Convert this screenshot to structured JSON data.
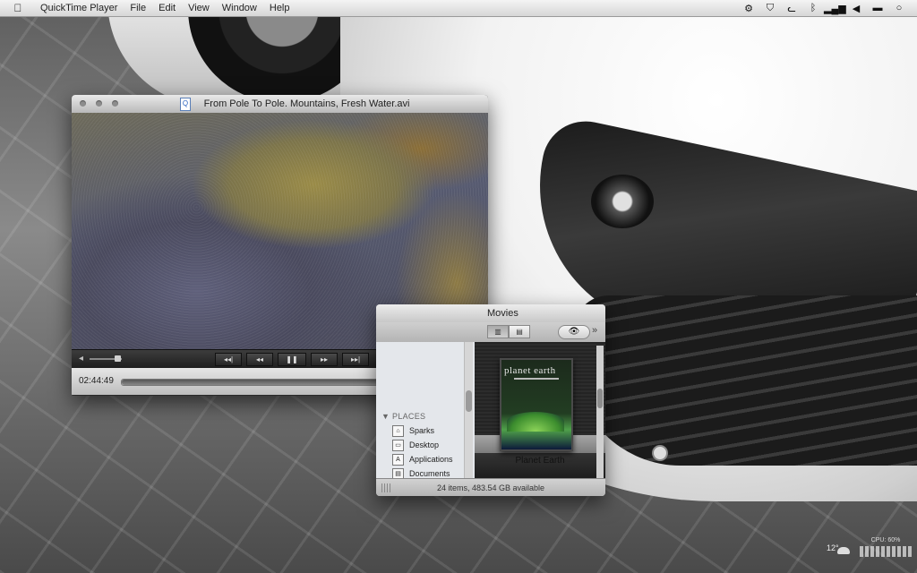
{
  "menubar": {
    "app_name": "QuickTime Player",
    "menus": [
      "File",
      "Edit",
      "View",
      "Window",
      "Help"
    ],
    "status_icons": [
      "gear-icon",
      "bird-icon",
      "cat-icon",
      "bluetooth-icon",
      "signal-icon",
      "volume-icon",
      "battery-icon",
      "spotlight-icon"
    ]
  },
  "quicktime": {
    "title": "From Pole To Pole. Mountains, Fresh Water.avi",
    "elapsed": "02:44:49",
    "progress": 0.92,
    "buttons": [
      "◂◂|",
      "◂◂",
      "❚❚",
      "▸▸",
      "▸▸|"
    ]
  },
  "finder": {
    "title": "Movies",
    "status": "24 items, 483.54 GB available",
    "sidebar": {
      "header": "PLACES",
      "items": [
        "Sparks",
        "Desktop",
        "Applications",
        "Documents"
      ]
    },
    "selected_item": "Planet Earth",
    "dvd_title": "planet earth"
  },
  "widgets": {
    "temperature": "12°",
    "cpu_label": "CPU: 60%"
  }
}
